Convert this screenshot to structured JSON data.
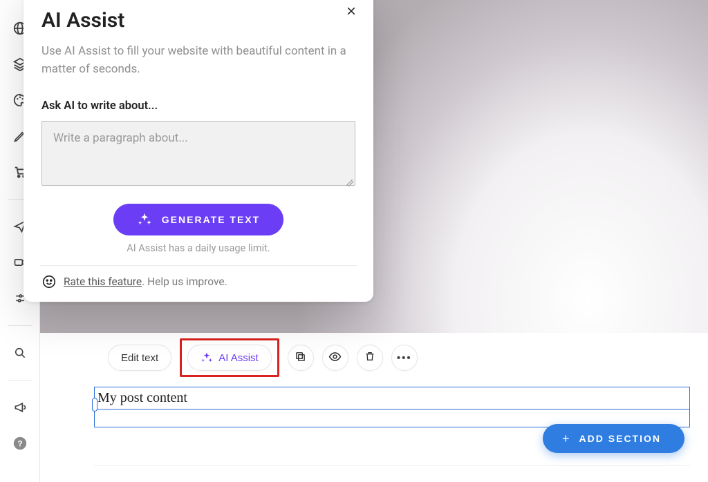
{
  "modal": {
    "title": "AI Assist",
    "description": "Use AI Assist to fill your website with beautiful content in a matter of seconds.",
    "prompt_label": "Ask AI to write about...",
    "textarea_placeholder": "Write a paragraph about...",
    "generate_label": "GENERATE TEXT",
    "limit_notice": "AI Assist has a daily usage limit.",
    "rate_link": "Rate this feature",
    "rate_trail": ". Help us improve."
  },
  "toolbar": {
    "edit_text": "Edit text",
    "ai_assist": "AI Assist"
  },
  "post": {
    "content": "My post content"
  },
  "add_section": {
    "label": "ADD SECTION"
  },
  "colors": {
    "accent_purple": "#6b3df5",
    "accent_blue": "#2f7de1",
    "highlight_red": "#d8221f"
  }
}
